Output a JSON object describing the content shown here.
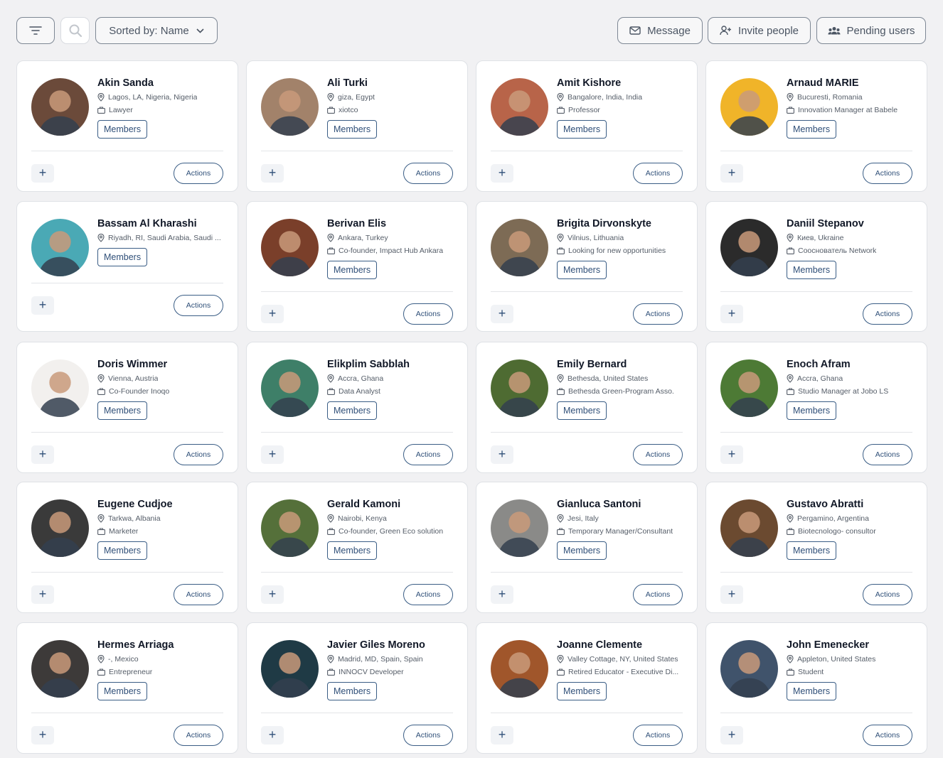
{
  "toolbar": {
    "sort_label": "Sorted by: Name",
    "message_label": "Message",
    "invite_label": "Invite people",
    "pending_label": "Pending users"
  },
  "card_common": {
    "members_label": "Members",
    "actions_label": "Actions",
    "add_label": "+"
  },
  "colors": {
    "accent": "#2f4f78",
    "border": "#7d8794",
    "background": "#f1f1f3"
  },
  "people": [
    {
      "name": "Akin Sanda",
      "location": "Lagos, LA, Nigeria, Nigeria",
      "role": "Lawyer",
      "avatar_color": "#6b4a3a"
    },
    {
      "name": "Ali Turki",
      "location": "giza, Egypt",
      "role": "xiotco",
      "avatar_color": "#a2826a"
    },
    {
      "name": "Amit Kishore",
      "location": "Bangalore, India, India",
      "role": "Professor",
      "avatar_color": "#b86449"
    },
    {
      "name": "Arnaud MARIE",
      "location": "Bucuresti, Romania",
      "role": "Innovation Manager at Babele",
      "avatar_color": "#f0b429"
    },
    {
      "name": "Bassam Al Kharashi",
      "location": "Riyadh, RI, Saudi Arabia, Saudi ...",
      "role": "",
      "avatar_color": "#4aa9b5"
    },
    {
      "name": "Berivan Elis",
      "location": "Ankara, Turkey",
      "role": "Co-founder, Impact Hub Ankara",
      "avatar_color": "#7a3f2a"
    },
    {
      "name": "Brigita Dirvonskyte",
      "location": "Vilnius, Lithuania",
      "role": "Looking for new opportunities",
      "avatar_color": "#7d6b55"
    },
    {
      "name": "Daniil Stepanov",
      "location": "Киев, Ukraine",
      "role": "Сооснователь Network",
      "avatar_color": "#2b2b2b"
    },
    {
      "name": "Doris Wimmer",
      "location": "Vienna, Austria",
      "role": "Co-Founder Inoqo",
      "avatar_color": "#f2f0ee"
    },
    {
      "name": "Elikplim Sabblah",
      "location": "Accra, Ghana",
      "role": "Data Analyst",
      "avatar_color": "#3e7f68"
    },
    {
      "name": "Emily Bernard",
      "location": "Bethesda, United States",
      "role": "Bethesda Green-Program Asso.",
      "avatar_color": "#4e6b32"
    },
    {
      "name": "Enoch Afram",
      "location": "Accra, Ghana",
      "role": "Studio Manager at Jobo LS",
      "avatar_color": "#4d7a35"
    },
    {
      "name": "Eugene Cudjoe",
      "location": "Tarkwa, Albania",
      "role": "Marketer",
      "avatar_color": "#3a3a3a"
    },
    {
      "name": "Gerald Kamoni",
      "location": "Nairobi, Kenya",
      "role": "Co-founder, Green Eco solution",
      "avatar_color": "#55703a"
    },
    {
      "name": "Gianluca Santoni",
      "location": "Jesi, Italy",
      "role": "Temporary Manager/Consultant",
      "avatar_color": "#8a8a88"
    },
    {
      "name": "Gustavo Abratti",
      "location": "Pergamino, Argentina",
      "role": "Biotecnologo- consultor",
      "avatar_color": "#6b4a30"
    },
    {
      "name": "Hermes Arriaga",
      "location": "-, Mexico",
      "role": "Entrepreneur",
      "avatar_color": "#3d3a39"
    },
    {
      "name": "Javier Giles Moreno",
      "location": "Madrid, MD, Spain, Spain",
      "role": "INNOCV Developer",
      "avatar_color": "#1f3a45"
    },
    {
      "name": "Joanne Clemente",
      "location": "Valley Cottage, NY, United States",
      "role": "Retired Educator - Executive Di...",
      "avatar_color": "#a0562b"
    },
    {
      "name": "John Emenecker",
      "location": "Appleton, United States",
      "role": "Student",
      "avatar_color": "#40536b"
    }
  ]
}
